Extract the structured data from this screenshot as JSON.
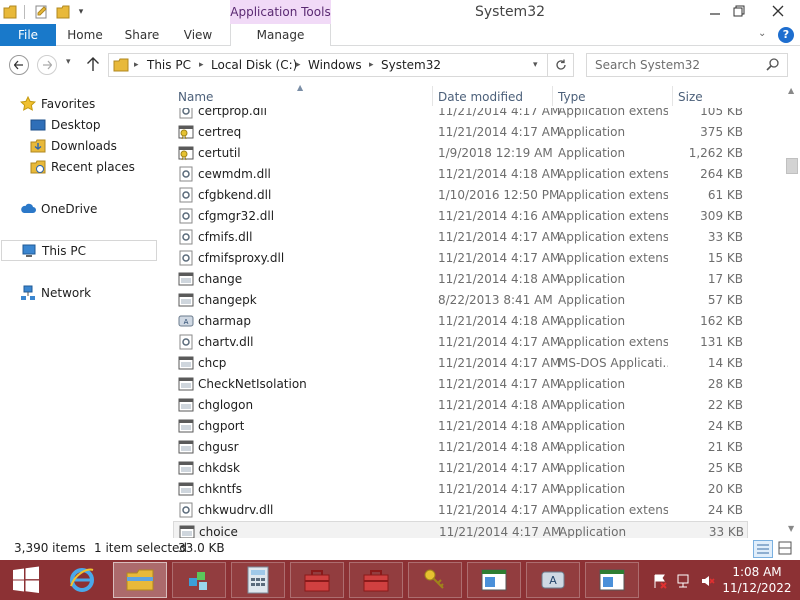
{
  "window": {
    "title": "System32",
    "contextual_tab_group": "Application Tools"
  },
  "ribbon": {
    "tabs": [
      "File",
      "Home",
      "Share",
      "View",
      "Manage"
    ]
  },
  "address": {
    "crumbs": [
      "This PC",
      "Local Disk (C:)",
      "Windows",
      "System32"
    ]
  },
  "search": {
    "placeholder": "Search System32"
  },
  "nav": {
    "favorites": "Favorites",
    "desktop": "Desktop",
    "downloads": "Downloads",
    "recent": "Recent places",
    "onedrive": "OneDrive",
    "thispc": "This PC",
    "network": "Network"
  },
  "columns": {
    "name": "Name",
    "date": "Date modified",
    "type": "Type",
    "size": "Size"
  },
  "files": [
    {
      "name": "certprop.dll",
      "date": "11/21/2014 4:17 AM",
      "type": "Application extens...",
      "size": "105 KB",
      "icon": "dll-icon"
    },
    {
      "name": "certreq",
      "date": "11/21/2014 4:17 AM",
      "type": "Application",
      "size": "375 KB",
      "icon": "cert-app-icon"
    },
    {
      "name": "certutil",
      "date": "1/9/2018 12:19 AM",
      "type": "Application",
      "size": "1,262 KB",
      "icon": "cert-app-icon"
    },
    {
      "name": "cewmdm.dll",
      "date": "11/21/2014 4:18 AM",
      "type": "Application extens...",
      "size": "264 KB",
      "icon": "dll-icon"
    },
    {
      "name": "cfgbkend.dll",
      "date": "1/10/2016 12:50 PM",
      "type": "Application extens...",
      "size": "61 KB",
      "icon": "dll-icon"
    },
    {
      "name": "cfgmgr32.dll",
      "date": "11/21/2014 4:16 AM",
      "type": "Application extens...",
      "size": "309 KB",
      "icon": "dll-icon"
    },
    {
      "name": "cfmifs.dll",
      "date": "11/21/2014 4:17 AM",
      "type": "Application extens...",
      "size": "33 KB",
      "icon": "dll-icon"
    },
    {
      "name": "cfmifsproxy.dll",
      "date": "11/21/2014 4:17 AM",
      "type": "Application extens...",
      "size": "15 KB",
      "icon": "dll-icon"
    },
    {
      "name": "change",
      "date": "11/21/2014 4:18 AM",
      "type": "Application",
      "size": "17 KB",
      "icon": "app-icon"
    },
    {
      "name": "changepk",
      "date": "8/22/2013 8:41 AM",
      "type": "Application",
      "size": "57 KB",
      "icon": "app-icon"
    },
    {
      "name": "charmap",
      "date": "11/21/2014 4:18 AM",
      "type": "Application",
      "size": "162 KB",
      "icon": "charmap-icon"
    },
    {
      "name": "chartv.dll",
      "date": "11/21/2014 4:17 AM",
      "type": "Application extens...",
      "size": "131 KB",
      "icon": "dll-icon"
    },
    {
      "name": "chcp",
      "date": "11/21/2014 4:17 AM",
      "type": "MS-DOS Applicati...",
      "size": "14 KB",
      "icon": "app-icon"
    },
    {
      "name": "CheckNetIsolation",
      "date": "11/21/2014 4:17 AM",
      "type": "Application",
      "size": "28 KB",
      "icon": "app-icon"
    },
    {
      "name": "chglogon",
      "date": "11/21/2014 4:18 AM",
      "type": "Application",
      "size": "22 KB",
      "icon": "app-icon"
    },
    {
      "name": "chgport",
      "date": "11/21/2014 4:18 AM",
      "type": "Application",
      "size": "24 KB",
      "icon": "app-icon"
    },
    {
      "name": "chgusr",
      "date": "11/21/2014 4:18 AM",
      "type": "Application",
      "size": "21 KB",
      "icon": "app-icon"
    },
    {
      "name": "chkdsk",
      "date": "11/21/2014 4:17 AM",
      "type": "Application",
      "size": "25 KB",
      "icon": "app-icon"
    },
    {
      "name": "chkntfs",
      "date": "11/21/2014 4:17 AM",
      "type": "Application",
      "size": "20 KB",
      "icon": "app-icon"
    },
    {
      "name": "chkwudrv.dll",
      "date": "11/21/2014 4:17 AM",
      "type": "Application extens...",
      "size": "24 KB",
      "icon": "dll-icon"
    },
    {
      "name": "choice",
      "date": "11/21/2014 4:17 AM",
      "type": "Application",
      "size": "33 KB",
      "icon": "app-icon",
      "selected": true
    }
  ],
  "status": {
    "count": "3,390 items",
    "selected": "1 item selected",
    "size": "33.0 KB"
  },
  "clock": {
    "time": "1:08 AM",
    "date": "11/12/2022"
  },
  "colors": {
    "file_tab": "#1979ca",
    "contextual_band": "#f1daf7",
    "taskbar": "#8c3134"
  }
}
